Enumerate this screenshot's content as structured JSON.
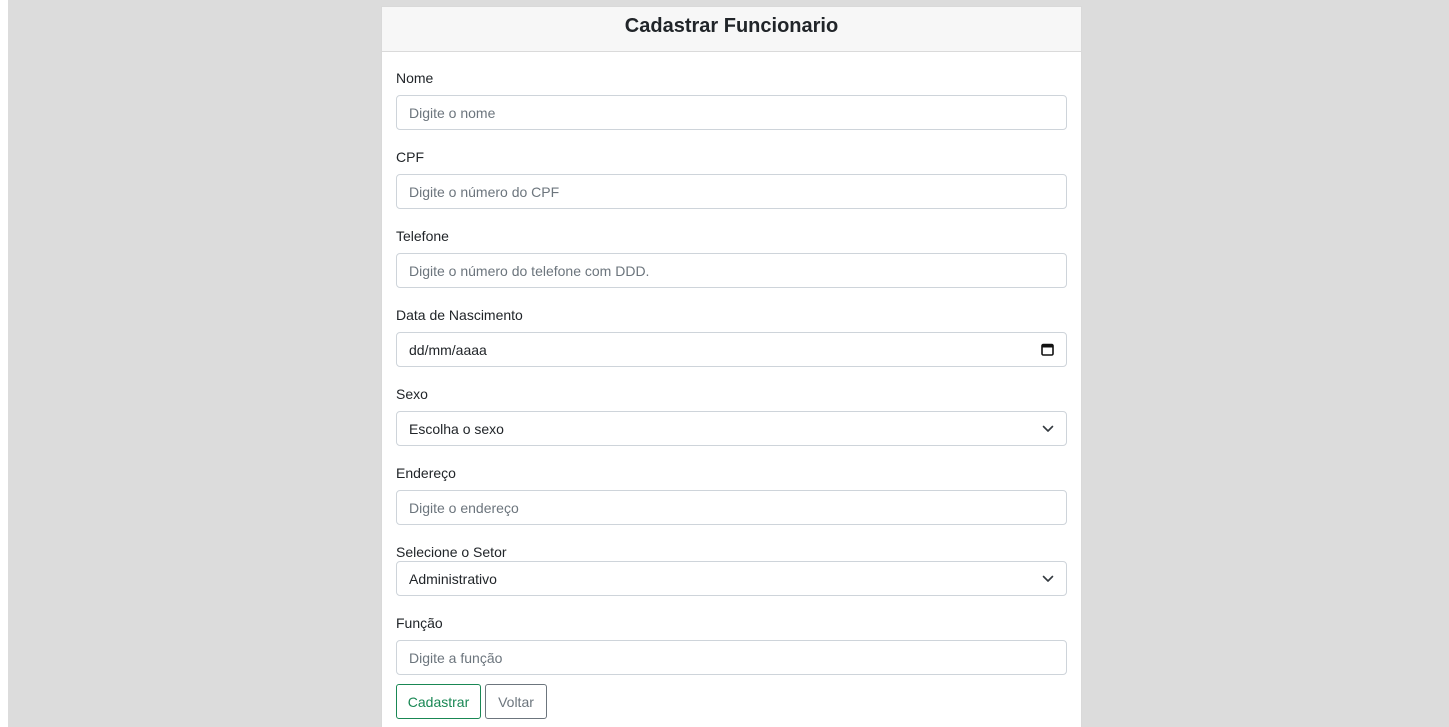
{
  "form": {
    "title": "Cadastrar Funcionario",
    "fields": {
      "nome": {
        "label": "Nome",
        "placeholder": "Digite o nome"
      },
      "cpf": {
        "label": "CPF",
        "placeholder": "Digite o número do CPF"
      },
      "telefone": {
        "label": "Telefone",
        "placeholder": "Digite o número do telefone com DDD."
      },
      "nascimento": {
        "label": "Data de Nascimento",
        "value": "dd/mm/aaaa"
      },
      "sexo": {
        "label": "Sexo",
        "selected": "Escolha o sexo"
      },
      "endereco": {
        "label": "Endereço",
        "placeholder": "Digite o endereço"
      },
      "setor": {
        "label": "Selecione o Setor",
        "selected": "Administrativo"
      },
      "funcao": {
        "label": "Função",
        "placeholder": "Digite a função"
      }
    },
    "buttons": {
      "submit_label": "Cadastrar",
      "back_label": "Voltar"
    }
  },
  "icons": {
    "date": "calendar-icon",
    "select": "chevron-down-icon"
  },
  "colors": {
    "page_background": "#dcdcdc",
    "header_background": "#f7f7f7",
    "submit_outline": "#198754",
    "back_outline": "#6c757d"
  }
}
